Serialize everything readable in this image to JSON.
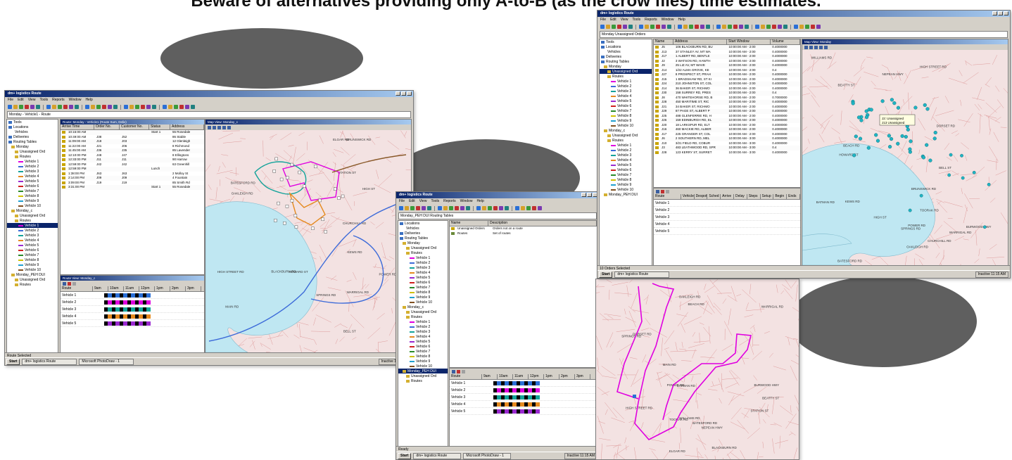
{
  "headline": "Beware of alternatives providing only A-to-B (as the crow flies) time estimates.",
  "colors": {
    "oval": "#5f5f5f",
    "titlebar": "#0a246a",
    "map_land": "#f3e2e2",
    "map_roads": "#d98a8a",
    "map_water": "#bfe7f2",
    "route_magenta": "#e000e0",
    "route_blue": "#3d6bd9",
    "route_teal": "#13a39a",
    "route_orange": "#e58a1f",
    "stop_cyan": "#1fb5c4"
  },
  "app": {
    "title": "dm+ logistics Route",
    "menu": [
      "File",
      "Edit",
      "View",
      "Tools",
      "Reports",
      "Window",
      "Help"
    ],
    "start_label": "Start",
    "taskbar_app": "dm+ logistics Route",
    "taskbar_ps": "Microsoft PhotoDraw - 1",
    "tray": "Inactive 11:15 AM"
  },
  "shot1": {
    "address": "Monday - Vehicle1 - Route",
    "tree": [
      "Tools",
      "Locations",
      "Vehicles",
      "Deliveries",
      "Routing Tables",
      "Monday",
      "Unassigned Ord",
      "Routes",
      "Vehicle 1",
      "Vehicle 2",
      "Vehicle 3",
      "Vehicle 4",
      "Vehicle 5",
      "Vehicle 6",
      "Vehicle 7",
      "Vehicle 8",
      "Vehicle 9",
      "Vehicle 10",
      "Monday_c",
      "Unassigned Ord",
      "Routes",
      "Vehicle 1",
      "Vehicle 2",
      "Vehicle 3",
      "Vehicle 4",
      "Vehicle 5",
      "Vehicle 6",
      "Vehicle 7",
      "Vehicle 8",
      "Vehicle 9",
      "Vehicle 10",
      "Monday_PEH DUI",
      "Unassigned Ord",
      "Routes"
    ],
    "selected_index": 21,
    "list_title": "Route: Monday - Vehicle1 (Route Sum, Deliv)",
    "columns": [
      "Arrive Time",
      "Order No.",
      "Customer No.",
      "Status",
      "Address"
    ],
    "rows": [
      [
        "10:15:00 AM",
        "",
        "",
        "Start 1",
        "55 Rosedale"
      ],
      [
        "10:49:00 AM",
        "J38",
        "J52",
        "",
        "86 Stable"
      ],
      [
        "11:09:00 AM",
        "J18",
        "J03",
        "",
        "12 Glenleigh"
      ],
      [
        "11:22:00 AM",
        "J21",
        "J06",
        "",
        "8 Richmond"
      ],
      [
        "11:45:00 AM",
        "J36",
        "J35",
        "",
        "85 Lavender"
      ],
      [
        "12:10:00 PM",
        "J48",
        "J47",
        "",
        "8 Ellingtons"
      ],
      [
        "12:33:00 PM",
        "J11",
        "J11",
        "",
        "90 Harrow"
      ],
      [
        "12:59:00 PM",
        "J42",
        "J42",
        "",
        "63 Greenhill"
      ],
      [
        "12:59:00 PM",
        "",
        "",
        "Lunch",
        ""
      ],
      [
        "1:38:00 PM",
        "J63",
        "J63",
        "",
        "2 Molloy St"
      ],
      [
        "2:14:00 PM",
        "J09",
        "J09",
        "",
        "4 Fountain"
      ],
      [
        "3:09:00 PM",
        "J19",
        "J19",
        "",
        "85 Smith Rd"
      ],
      [
        "3:31:00 PM",
        "",
        "",
        "Start 1",
        "55 Rosedale"
      ]
    ],
    "map_title": "Map View: Monday_c",
    "sched_title": "Route View: Monday_c",
    "sched_columns": [
      "Route",
      "9am",
      "10am",
      "11am",
      "12pm",
      "1pm",
      "2pm",
      "3pm"
    ],
    "sched_rows": [
      "Vehicle 1",
      "Vehicle 2",
      "Vehicle 3",
      "Vehicle 4",
      "Vehicle 5"
    ],
    "status": "Route Selected"
  },
  "shot2": {
    "address": "Monday_PEH DUI Routing Tables",
    "tree": [
      "Locations",
      "Vehicles",
      "Deliveries",
      "Routing Tables",
      "Monday",
      "Unassigned Ord",
      "Routes",
      "Vehicle 1",
      "Vehicle 2",
      "Vehicle 3",
      "Vehicle 4",
      "Vehicle 5",
      "Vehicle 6",
      "Vehicle 7",
      "Vehicle 8",
      "Vehicle 9",
      "Vehicle 10",
      "Monday_c",
      "Unassigned Ord",
      "Routes",
      "Vehicle 1",
      "Vehicle 2",
      "Vehicle 3",
      "Vehicle 4",
      "Vehicle 5",
      "Vehicle 6",
      "Vehicle 7",
      "Vehicle 8",
      "Vehicle 9",
      "Vehicle 10",
      "Monday_PEH DUI",
      "Unassigned Ord",
      "Routes"
    ],
    "selected_index": 30,
    "list_columns": [
      "Name",
      "Description"
    ],
    "list_rows": [
      [
        "Unassigned Orders",
        "Orders not on a route"
      ],
      [
        "Routes",
        "Set of routes"
      ]
    ],
    "sched_columns": [
      "Route",
      "9am",
      "10am",
      "11am",
      "12pm",
      "1pm",
      "2pm",
      "3pm"
    ],
    "sched_rows": [
      "Vehicle 1",
      "Vehicle 2",
      "Vehicle 3",
      "Vehicle 4",
      "Vehicle 5"
    ],
    "status": "Ready"
  },
  "shot3": {
    "address": "Monday Unassigned Orders",
    "tree": [
      "Tools",
      "Locations",
      "Vehicles",
      "Deliveries",
      "Routing Tables",
      "Monday",
      "Unassigned Ord",
      "Routes",
      "Vehicle 1",
      "Vehicle 2",
      "Vehicle 3",
      "Vehicle 4",
      "Vehicle 5",
      "Vehicle 6",
      "Vehicle 7",
      "Vehicle 8",
      "Vehicle 9",
      "Vehicle 10",
      "Monday_c",
      "Unassigned Ord",
      "Routes",
      "Vehicle 1",
      "Vehicle 2",
      "Vehicle 3",
      "Vehicle 4",
      "Vehicle 5",
      "Vehicle 6",
      "Vehicle 7",
      "Vehicle 8",
      "Vehicle 9",
      "Vehicle 10",
      "Monday_PEH DUI"
    ],
    "selected_index": 6,
    "list_columns": [
      "Name",
      "Address",
      "Start Window",
      "Volume"
    ],
    "list_rows": [
      [
        "J5",
        "106 BLACKBURN RD, BU",
        "10:00:00 AM - 2:00",
        "0.4000000"
      ],
      [
        "J13",
        "37 STANLEY AV, MT WA",
        "10:00:00 AM - 2:00",
        "0.4000000"
      ],
      [
        "J17",
        "1 ALBERT RD, BENTLE",
        "10:00:00 AM - 2:00",
        "0.4000000"
      ],
      [
        "J2",
        "3 WATSON RD, HAWTH",
        "10:00:00 AM - 2:00",
        "0.4000000"
      ],
      [
        "J9",
        "25 LIZ AV, MT WAVE",
        "10:00:00 AM - 2:00",
        "0.4000000"
      ],
      [
        "J14",
        "1/22 ALMA GROVE, KE",
        "10:00:00 AM - 2:00",
        "0.4"
      ],
      [
        "J27",
        "8 PROSPECT ST, PRAH",
        "10:00:00 AM - 2:00",
        "0.4000000"
      ],
      [
        "J15",
        "1 BRADSHAW RD, ST KI",
        "10:00:00 AM - 2:00",
        "0.4000000"
      ],
      [
        "J24",
        "210 JOHNSTON ST, COL",
        "10:00:00 AM - 2:00",
        "0.4000000"
      ],
      [
        "J14",
        "36 BAKER ST, RICHMO",
        "10:00:00 AM - 2:00",
        "0.4000000"
      ],
      [
        "J30",
        "158 SURREY RD, PRES",
        "10:00:00 AM - 2:00",
        "0.4"
      ],
      [
        "J8",
        "470 WHITEHORSE RD, B",
        "10:00:00 AM - 2:00",
        "0.7000000"
      ],
      [
        "J28",
        "450 MARITIME ST, RIC",
        "10:00:00 AM - 2:00",
        "0.4000000"
      ],
      [
        "J21",
        "34 BAKER ST, RICHMO",
        "10:00:00 AM - 2:00",
        "0.4000000"
      ],
      [
        "J29",
        "87 PAGE ST, ALBERT P",
        "10:00:00 AM - 2:00",
        "0.4000000"
      ],
      [
        "J25",
        "488 GLENFERRIE RD, H",
        "10:00:00 AM - 2:00",
        "0.4000000"
      ],
      [
        "J26",
        "159 EDINBURGH RD, EL",
        "10:00:00 AM - 2:00",
        "0.4000000"
      ],
      [
        "J20",
        "18 LARKSPUR RD, ELT",
        "10:00:00 AM - 2:00",
        "0.4000000"
      ],
      [
        "J16",
        "460 MACKIE RD, ALBER",
        "10:00:00 AM - 2:00",
        "0.4000000"
      ],
      [
        "J17",
        "225 GRANGER ST, COL",
        "10:00:00 AM - 2:00",
        "0.4000000"
      ],
      [
        "J6",
        "2 SOUTHERN RD, MEL",
        "10:00:00 AM - 3:00",
        "0.4000000"
      ],
      [
        "J10",
        "3/21 FIELD RD, COBUR",
        "10:00:00 AM - 3:00",
        "0.4000000"
      ],
      [
        "J3",
        "483 LEATHWOOD RD, SPR",
        "10:00:00 AM - 3:00",
        "0.4"
      ],
      [
        "J28",
        "123 KERRY ST, SURRET",
        "10:00:00 AM - 3:00",
        "0.4000000"
      ]
    ],
    "map_title": "Map View: Monday",
    "callout": [
      "J2: Unassigned",
      "J13 Unassigned"
    ],
    "sched_columns": [
      "Route",
      "Vehicle",
      "Despot",
      "Sched",
      "Arrive",
      "Delay",
      "Steps",
      "Setup",
      "Begin",
      "Ends"
    ],
    "sched_rows": [
      "Vehicle 1",
      "Vehicle 2",
      "Vehicle 3",
      "Vehicle 4",
      "Vehicle 5"
    ],
    "status": "10 Orders Selected"
  },
  "street_labels": [
    "BRUNSWICK RD",
    "CHURCHILL RD",
    "KEWS RD",
    "HIGH ST",
    "HOWARD ST",
    "BELL ST",
    "MAIN RD",
    "BLACKBURN RD",
    "STATION ST",
    "ELGAR RD",
    "WARRIGAL RD",
    "HIGH STREET RD",
    "BATESFORD RD",
    "OAKLEIGH RD",
    "POWER RD",
    "SPRINGS RD",
    "BEACH RD",
    "BEATTY ST",
    "WILLIAMS RD",
    "BATMAN RD",
    "DORSET RD",
    "BURWOOD HWY",
    "NEPEAN HWY",
    "TOORAK RD"
  ]
}
